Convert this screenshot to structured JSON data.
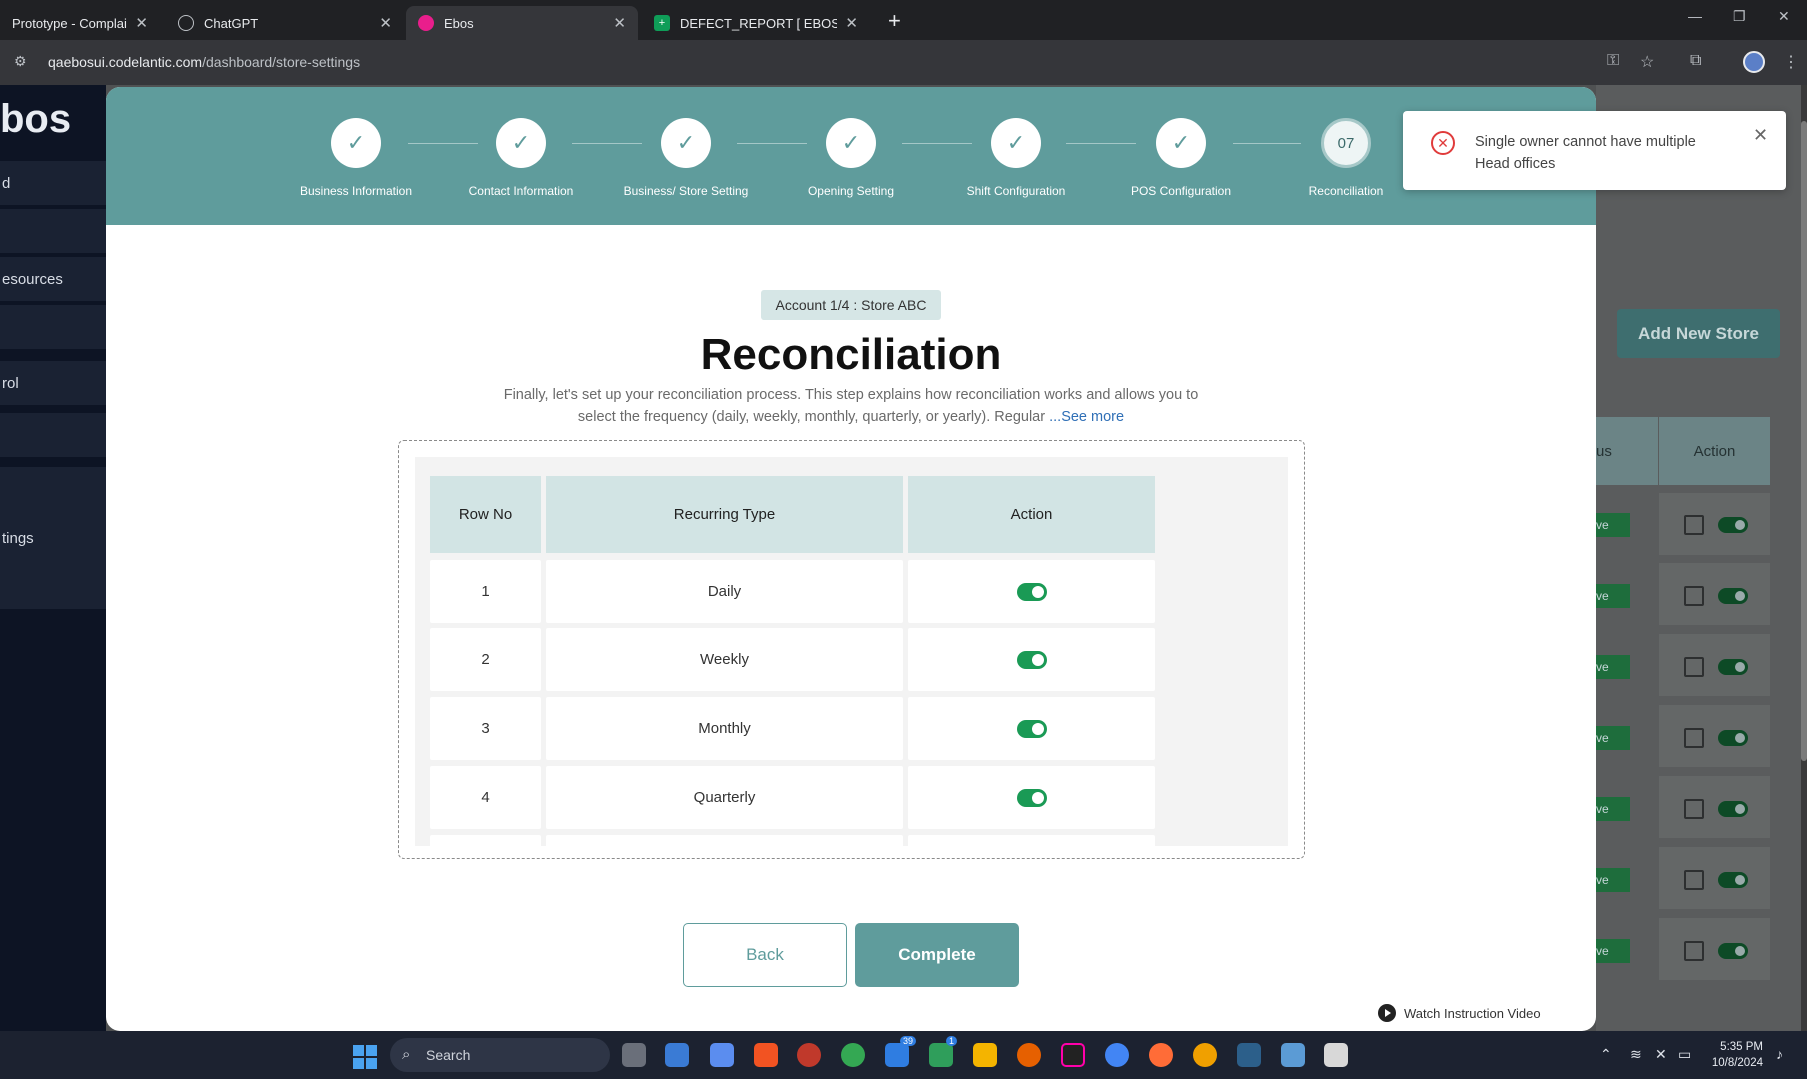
{
  "browser": {
    "tabs": [
      {
        "title": "Prototype - Complains W",
        "favicon_color": "#3b3b3b",
        "active": false
      },
      {
        "title": "ChatGPT",
        "favicon_color": "#202124",
        "active": false
      },
      {
        "title": "Ebos",
        "favicon_color": "#e91e8c",
        "active": true
      },
      {
        "title": "DEFECT_REPORT [ EBOS ] - Goo",
        "favicon_color": "#0f9d58",
        "active": false
      }
    ],
    "url_domain": "qaebosui.codelantic.com",
    "url_path": "/dashboard/store-settings"
  },
  "background_app": {
    "logo": "bos",
    "sidebar_items": [
      "d",
      "esources",
      "rol",
      "tings"
    ],
    "add_store_label": "Add New Store",
    "table_head_status": "us",
    "table_head_action": "Action",
    "status_label": "ve"
  },
  "stepper": {
    "steps": [
      {
        "label": "Business Information",
        "mark": "✓"
      },
      {
        "label": "Contact Information",
        "mark": "✓"
      },
      {
        "label": "Business/ Store Setting",
        "mark": "✓"
      },
      {
        "label": "Opening Setting",
        "mark": "✓"
      },
      {
        "label": "Shift Configuration",
        "mark": "✓"
      },
      {
        "label": "POS Configuration",
        "mark": "✓"
      },
      {
        "label": "Reconciliation",
        "mark": "07"
      }
    ]
  },
  "main": {
    "account_badge": "Account 1/4 : Store ABC",
    "title": "Reconciliation",
    "description": "Finally, let's set up your reconciliation process. This step explains how reconciliation works and allows you to select the frequency (daily, weekly, monthly, quarterly, or yearly). Regular",
    "see_more": "...See more",
    "table": {
      "headers": [
        "Row No",
        "Recurring Type",
        "Action"
      ],
      "rows": [
        {
          "no": "1",
          "type": "Daily",
          "enabled": true
        },
        {
          "no": "2",
          "type": "Weekly",
          "enabled": true
        },
        {
          "no": "3",
          "type": "Monthly",
          "enabled": true
        },
        {
          "no": "4",
          "type": "Quarterly",
          "enabled": true
        }
      ]
    },
    "back_label": "Back",
    "complete_label": "Complete",
    "watch_video_label": "Watch Instruction Video"
  },
  "toast": {
    "message": "Single owner cannot have multiple Head offices"
  },
  "taskbar": {
    "search_placeholder": "Search",
    "mail_badge": "39",
    "app_badge": "1",
    "time": "5:35 PM",
    "date": "10/8/2024"
  },
  "colors": {
    "teal": "#5f9c9c",
    "toggle_on": "#1a9a55",
    "error": "#e03b3b"
  }
}
